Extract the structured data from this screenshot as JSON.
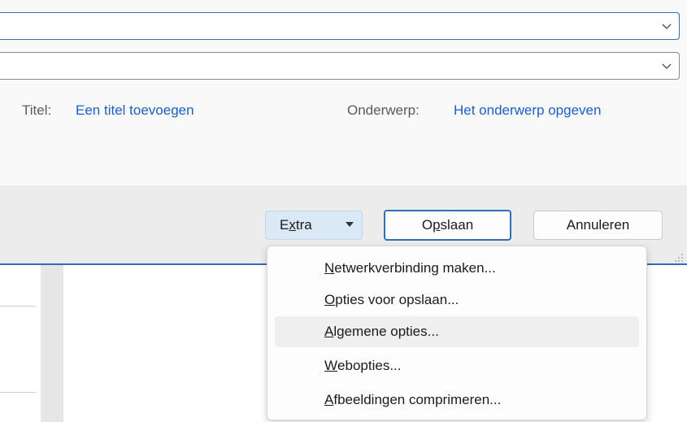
{
  "dialog": {
    "combo1": {
      "value": ""
    },
    "combo2": {
      "value": ""
    },
    "meta": {
      "title_label": "Titel:",
      "title_link": "Een titel toevoegen",
      "subject_label": "Onderwerp:",
      "subject_link": "Het onderwerp opgeven"
    },
    "buttons": {
      "extra_pre": "E",
      "extra_ul": "x",
      "extra_post": "tra",
      "save_pre": "O",
      "save_ul": "p",
      "save_post": "slaan",
      "cancel": "Annuleren"
    },
    "menu": {
      "items": [
        {
          "ul": "N",
          "rest": "etwerkverbinding maken..."
        },
        {
          "ul": "O",
          "rest": "pties voor opslaan..."
        },
        {
          "ul": "A",
          "rest": "lgemene opties..."
        },
        {
          "ul": "W",
          "rest": "ebopties..."
        },
        {
          "ul": "A",
          "rest": "fbeeldingen comprimeren..."
        }
      ]
    },
    "colors": {
      "accent": "#2d6fb8",
      "link": "#1a5fc1",
      "extra_bg": "#dbe8f6"
    }
  }
}
